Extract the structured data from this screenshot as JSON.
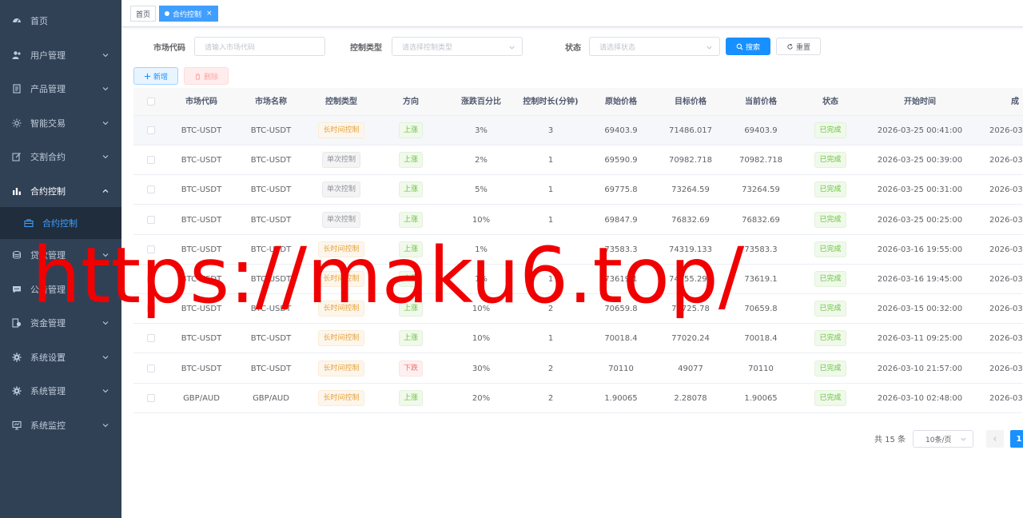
{
  "sidebar": {
    "items": [
      {
        "label": "首页",
        "icon": "dashboard-icon",
        "has_arrow": false
      },
      {
        "label": "用户管理",
        "icon": "users-icon",
        "has_arrow": true
      },
      {
        "label": "产品管理",
        "icon": "document-icon",
        "has_arrow": true
      },
      {
        "label": "智能交易",
        "icon": "sun-icon",
        "has_arrow": true
      },
      {
        "label": "交割合约",
        "icon": "edit-icon",
        "has_arrow": true
      },
      {
        "label": "合约控制",
        "icon": "bar-chart-icon",
        "has_arrow": true,
        "expanded": true
      },
      {
        "label": "贷款管理",
        "icon": "loan-icon",
        "has_arrow": true
      },
      {
        "label": "公告管理",
        "icon": "message-icon",
        "has_arrow": false
      },
      {
        "label": "资金管理",
        "icon": "money-icon",
        "has_arrow": true
      },
      {
        "label": "系统设置",
        "icon": "settings-icon",
        "has_arrow": true
      },
      {
        "label": "系统管理",
        "icon": "system-icon",
        "has_arrow": true
      },
      {
        "label": "系统监控",
        "icon": "monitor-icon",
        "has_arrow": true
      }
    ],
    "sub_item": {
      "label": "合约控制",
      "icon": "briefcase-icon"
    }
  },
  "tags": {
    "home": "首页",
    "active": "合约控制",
    "close": "×"
  },
  "search": {
    "market_code_label": "市场代码",
    "market_code_placeholder": "请输入市场代码",
    "control_type_label": "控制类型",
    "control_type_placeholder": "请选择控制类型",
    "status_label": "状态",
    "status_placeholder": "请选择状态",
    "search_button": "搜索",
    "reset_button": "重置"
  },
  "toolbar": {
    "add_button": "新增",
    "delete_button": "删除"
  },
  "table": {
    "columns": [
      "市场代码",
      "市场名称",
      "控制类型",
      "方向",
      "涨跌百分比",
      "控制时长(分钟)",
      "原始价格",
      "目标价格",
      "当前价格",
      "状态",
      "开始时间",
      "成"
    ],
    "rows": [
      {
        "code": "BTC-USDT",
        "name": "BTC-USDT",
        "type": "长时间控制",
        "type_kind": "warn",
        "dir": "上涨",
        "dir_kind": "succ",
        "pct": "3%",
        "dur": "3",
        "orig": "69403.9",
        "target": "71486.017",
        "cur": "69403.9",
        "status": "已完成",
        "start": "2026-03-25 00:41:00",
        "end": "2026-03"
      },
      {
        "code": "BTC-USDT",
        "name": "BTC-USDT",
        "type": "单次控制",
        "type_kind": "info",
        "dir": "上涨",
        "dir_kind": "succ",
        "pct": "2%",
        "dur": "1",
        "orig": "69590.9",
        "target": "70982.718",
        "cur": "70982.718",
        "status": "已完成",
        "start": "2026-03-25 00:39:00",
        "end": "2026-03"
      },
      {
        "code": "BTC-USDT",
        "name": "BTC-USDT",
        "type": "单次控制",
        "type_kind": "info",
        "dir": "上涨",
        "dir_kind": "succ",
        "pct": "5%",
        "dur": "1",
        "orig": "69775.8",
        "target": "73264.59",
        "cur": "73264.59",
        "status": "已完成",
        "start": "2026-03-25 00:31:00",
        "end": "2026-03"
      },
      {
        "code": "BTC-USDT",
        "name": "BTC-USDT",
        "type": "单次控制",
        "type_kind": "info",
        "dir": "上涨",
        "dir_kind": "succ",
        "pct": "10%",
        "dur": "1",
        "orig": "69847.9",
        "target": "76832.69",
        "cur": "76832.69",
        "status": "已完成",
        "start": "2026-03-25 00:25:00",
        "end": "2026-03"
      },
      {
        "code": "BTC-USDT",
        "name": "BTC-USDT",
        "type": "长时间控制",
        "type_kind": "warn",
        "dir": "上涨",
        "dir_kind": "succ",
        "pct": "1%",
        "dur": "1",
        "orig": "73583.3",
        "target": "74319.133",
        "cur": "73583.3",
        "status": "已完成",
        "start": "2026-03-16 19:55:00",
        "end": "2026-03"
      },
      {
        "code": "BTC-USDT",
        "name": "BTC-USDT",
        "type": "长时间控制",
        "type_kind": "warn",
        "dir": "上涨",
        "dir_kind": "succ",
        "pct": "1%",
        "dur": "1",
        "orig": "73619.1",
        "target": "74355.291",
        "cur": "73619.1",
        "status": "已完成",
        "start": "2026-03-16 19:45:00",
        "end": "2026-03"
      },
      {
        "code": "BTC-USDT",
        "name": "BTC-USDT",
        "type": "长时间控制",
        "type_kind": "warn",
        "dir": "上涨",
        "dir_kind": "succ",
        "pct": "10%",
        "dur": "2",
        "orig": "70659.8",
        "target": "77725.78",
        "cur": "70659.8",
        "status": "已完成",
        "start": "2026-03-15 00:32:00",
        "end": "2026-03"
      },
      {
        "code": "BTC-USDT",
        "name": "BTC-USDT",
        "type": "长时间控制",
        "type_kind": "warn",
        "dir": "上涨",
        "dir_kind": "succ",
        "pct": "10%",
        "dur": "1",
        "orig": "70018.4",
        "target": "77020.24",
        "cur": "70018.4",
        "status": "已完成",
        "start": "2026-03-11 09:25:00",
        "end": "2026-03"
      },
      {
        "code": "BTC-USDT",
        "name": "BTC-USDT",
        "type": "长时间控制",
        "type_kind": "warn",
        "dir": "下跌",
        "dir_kind": "dang",
        "pct": "30%",
        "dur": "2",
        "orig": "70110",
        "target": "49077",
        "cur": "70110",
        "status": "已完成",
        "start": "2026-03-10 21:57:00",
        "end": "2026-03"
      },
      {
        "code": "GBP/AUD",
        "name": "GBP/AUD",
        "type": "长时间控制",
        "type_kind": "warn",
        "dir": "上涨",
        "dir_kind": "succ",
        "pct": "20%",
        "dur": "2",
        "orig": "1.90065",
        "target": "2.28078",
        "cur": "1.90065",
        "status": "已完成",
        "start": "2026-03-10 02:48:00",
        "end": "2026-03"
      }
    ]
  },
  "pagination": {
    "total": "共 15 条",
    "page_size": "10条/页",
    "current": "1"
  },
  "watermark": "https://maku6.top/",
  "colors": {
    "sidebar_bg": "#304156",
    "primary": "#1890ff",
    "watermark": "#f00000"
  }
}
